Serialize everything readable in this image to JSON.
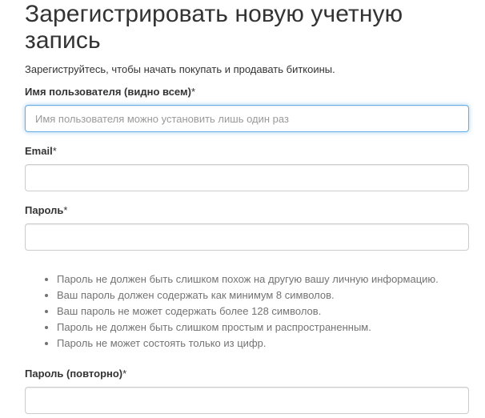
{
  "page": {
    "title": "Зарегистрировать новую учетную запись",
    "subtitle": "Зарегиструйтесь, чтобы начать покупать и продавать биткоины."
  },
  "form": {
    "username": {
      "label": "Имя пользователя (видно всем)",
      "required_mark": "*",
      "value": "",
      "placeholder": "Имя пользователя можно установить лишь один раз"
    },
    "email": {
      "label": "Email",
      "required_mark": "*",
      "value": "",
      "placeholder": ""
    },
    "password": {
      "label": "Пароль",
      "required_mark": "*",
      "value": "",
      "placeholder": ""
    },
    "password_help": [
      "Пароль не должен быть слишком похож на другую вашу личную информацию.",
      "Ваш пароль должен содержать как минимум 8 символов.",
      "Ваш пароль не может содержать более 128 символов.",
      "Пароль не должен быть слишком простым и распространенным.",
      "Пароль не может состоять только из цифр."
    ],
    "password_repeat": {
      "label": "Пароль (повторно)",
      "required_mark": "*",
      "value": "",
      "placeholder": ""
    }
  },
  "colors": {
    "text": "#333333",
    "help_text": "#737373",
    "input_border": "#cccccc",
    "focus_border": "#66afe9"
  }
}
